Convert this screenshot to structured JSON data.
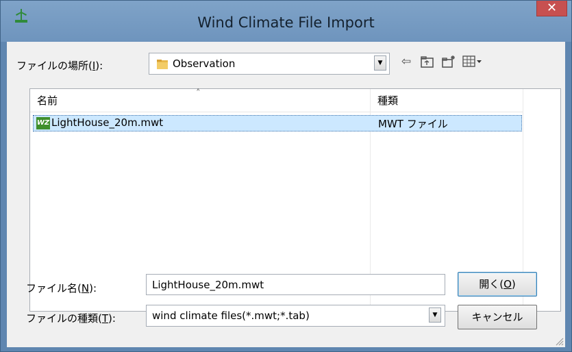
{
  "window": {
    "title": "Wind Climate File Import",
    "close_label": "✕"
  },
  "look_in": {
    "label_prefix": "ファイルの場所(",
    "label_key": "I",
    "label_suffix": "):",
    "value": "Observation"
  },
  "toolbar": {
    "back_icon": "⇦",
    "up_folder_icon": "up-folder-icon",
    "new_folder_icon": "new-folder-icon",
    "view_menu_icon": "view-menu-icon"
  },
  "file_list": {
    "columns": [
      "名前",
      "種類"
    ],
    "sort_indicator": "˄",
    "rows": [
      {
        "icon_text": "WZ",
        "name": "LightHouse_20m.mwt",
        "type": "MWT ファイル"
      }
    ]
  },
  "file_name": {
    "label_prefix": "ファイル名(",
    "label_key": "N",
    "label_suffix": "):",
    "value": "LightHouse_20m.mwt"
  },
  "file_type": {
    "label_prefix": "ファイルの種類(",
    "label_key": "T",
    "label_suffix": "):",
    "value": "wind climate files(*.mwt;*.tab)"
  },
  "buttons": {
    "open_prefix": "開く(",
    "open_key": "O",
    "open_suffix": ")",
    "cancel": "キャンセル"
  },
  "colors": {
    "titlebar": "#6e94bd",
    "close": "#c75050",
    "selection": "#cce8ff",
    "folder": "#e8b84a"
  }
}
